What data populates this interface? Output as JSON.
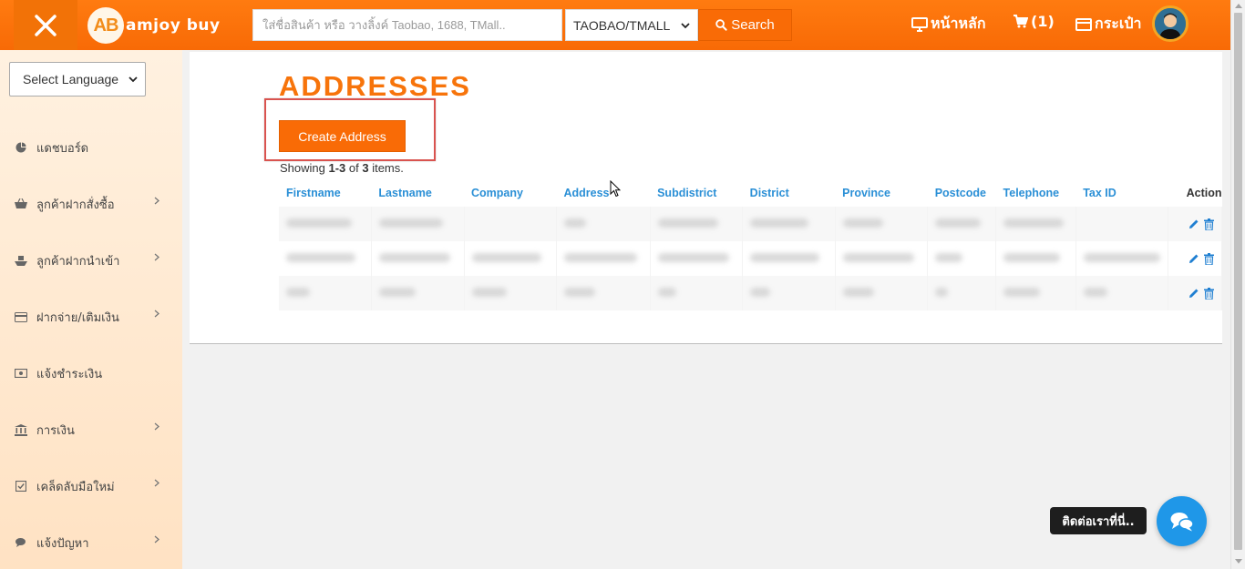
{
  "header": {
    "logo_mark": "AB",
    "logo_text": "amjoy buy",
    "search_placeholder": "ใส่ชื่อสินค้า หรือ วางลิ้งค์ Taobao, 1688, TMall..",
    "platform_selected": "TAOBAO/TMALL",
    "search_label": "Search",
    "home_label": "หน้าหลัก",
    "cart_label": "(1)",
    "wallet_label": "กระเป๋า"
  },
  "sidebar": {
    "language_select": "Select Language",
    "items": [
      {
        "label": "แดชบอร์ด",
        "icon": "pie-chart-icon"
      },
      {
        "label": "ลูกค้าฝากสั่งซื้อ",
        "icon": "basket-icon"
      },
      {
        "label": "ลูกค้าฝากนำเข้า",
        "icon": "ship-icon"
      },
      {
        "label": "ฝากจ่าย/เติมเงิน",
        "icon": "credit-card-icon"
      },
      {
        "label": "แจ้งชำระเงิน",
        "icon": "money-icon"
      },
      {
        "label": "การเงิน",
        "icon": "bank-icon"
      },
      {
        "label": "เคล็ดลับมือใหม่",
        "icon": "checkbox-icon"
      },
      {
        "label": "แจ้งปัญหา",
        "icon": "comments-icon"
      }
    ]
  },
  "main": {
    "title": "ADDRESSES",
    "create_button": "Create Address",
    "summary_prefix": "Showing ",
    "summary_range": "1-3",
    "summary_mid": " of ",
    "summary_total": "3",
    "summary_suffix": " items.",
    "columns": [
      "Firstname",
      "Lastname",
      "Company",
      "Address",
      "Subdistrict",
      "District",
      "Province",
      "Postcode",
      "Telephone",
      "Tax ID",
      "Action"
    ]
  },
  "chat": {
    "tooltip": "ติดต่อเราที่นี่.."
  },
  "colors": {
    "brand_orange": "#f96b06",
    "link_blue": "#2a8fd6",
    "chat_blue": "#1f97e8"
  }
}
